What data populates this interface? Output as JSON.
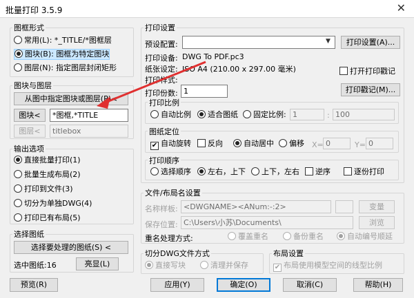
{
  "window": {
    "title": "批量打印 3.5.9",
    "close": "✕"
  },
  "frame_style": {
    "label": "图框形式",
    "options": [
      "常用(L): *_TITLE/*图框层",
      "图块(B): 图框为特定图块",
      "图层(N): 指定图层封闭矩形"
    ],
    "selected": 1
  },
  "block_layer": {
    "label": "图块与图层",
    "pick_button": "从图中指定图块或图层(P)<",
    "block_button": "图块<",
    "block_value": "*图框,*TITLE",
    "layer_button": "图层<",
    "layer_value": "titlebox"
  },
  "output": {
    "label": "输出选项",
    "options": [
      "直接批量打印(1)",
      "批量生成布局(2)",
      "打印到文件(3)",
      "切分为单独DWG(4)",
      "打印已有布局(5)"
    ],
    "selected": 0
  },
  "select_frames": {
    "label": "选择图纸",
    "select_button": "选择要处理的图纸(S) <",
    "count_text": "选中图纸:16",
    "highlight_button": "亮显(L)"
  },
  "print_settings": {
    "label": "打印设置",
    "preset_label": "预设配置:",
    "preset_value": "",
    "print_settings_button": "打印设置(A)...",
    "device_label": "打印设备:",
    "device_value": "DWG To PDF.pc3",
    "paper_label": "纸张设定:",
    "paper_value": "ISO A4 (210.00 x 297.00 毫米)",
    "style_label": "打印样式:",
    "copies_label": "打印份数:",
    "copies_value": "1",
    "open_log_label": "打开打印戳记",
    "stamp_button": "打印戳记(M)..."
  },
  "scale": {
    "label": "打印比例",
    "options": [
      "自动比例",
      "适合图纸",
      "固定比例:"
    ],
    "selected": 1,
    "fixed_left": "1",
    "fixed_colon": ":",
    "fixed_right": "100"
  },
  "position": {
    "label": "图纸定位",
    "auto_rotate": "自动旋转",
    "reverse": "反向",
    "auto_center": "自动居中",
    "offset": "偏移",
    "x_label": "X=",
    "x_value": "0",
    "y_label": "Y=",
    "y_value": "0"
  },
  "order": {
    "label": "打印顺序",
    "options": [
      "选择顺序",
      "左右，上下",
      "上下，左右"
    ],
    "selected": 1,
    "reverse": "逆序",
    "one_by_one": "逐份打印"
  },
  "file_layout": {
    "label": "文件/布局名设置",
    "name_label": "名称样板:",
    "name_value": "<DWGNAME><ANum:-:2>",
    "change_button": "变量",
    "save_label": "保存位置:",
    "save_value": "C:\\Users\\小苏\\Documents\\",
    "browse_button": "浏览",
    "dup_label": "重名处理方式:",
    "dup_options": [
      "覆盖重名",
      "备份重名",
      "自动编号顺延"
    ],
    "dup_selected": 2
  },
  "split": {
    "label": "切分DWG文件方式",
    "options": [
      "直接写块",
      "清理并保存"
    ],
    "selected": 0
  },
  "layout_settings": {
    "label": "布局设置",
    "model_linetype": "布局使用模型空间的线型比例"
  },
  "buttons": {
    "preview": "预览(R)",
    "apply": "应用(Y)",
    "ok": "确定(O)",
    "cancel": "取消(C)",
    "help": "帮助(H)"
  },
  "colors": {
    "arrow": "#e03030",
    "focus": "#0078d7"
  }
}
